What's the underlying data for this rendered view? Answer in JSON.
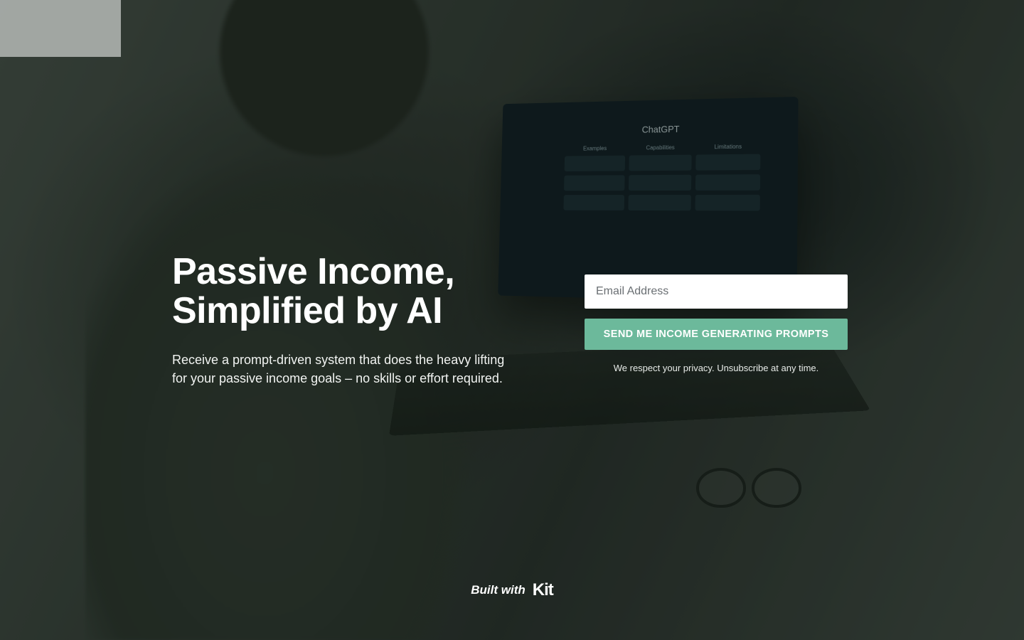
{
  "hero": {
    "headline_line1": "Passive Income,",
    "headline_line2": "Simplified by AI",
    "subhead": "Receive a prompt-driven system that does the heavy lifting for your passive income goals – no skills or effort required."
  },
  "form": {
    "email_placeholder": "Email Address",
    "cta_label": "SEND ME INCOME GENERATING PROMPTS",
    "privacy_text": "We respect your privacy. Unsubscribe at any time."
  },
  "badge": {
    "prefix": "Built with",
    "brand": "Kit"
  },
  "background": {
    "laptop_screen_title": "ChatGPT",
    "laptop_columns": [
      "Examples",
      "Capabilities",
      "Limitations"
    ]
  },
  "colors": {
    "cta_bg": "#6cb99b",
    "overlay": "rgba(15,25,18,0.35)"
  }
}
